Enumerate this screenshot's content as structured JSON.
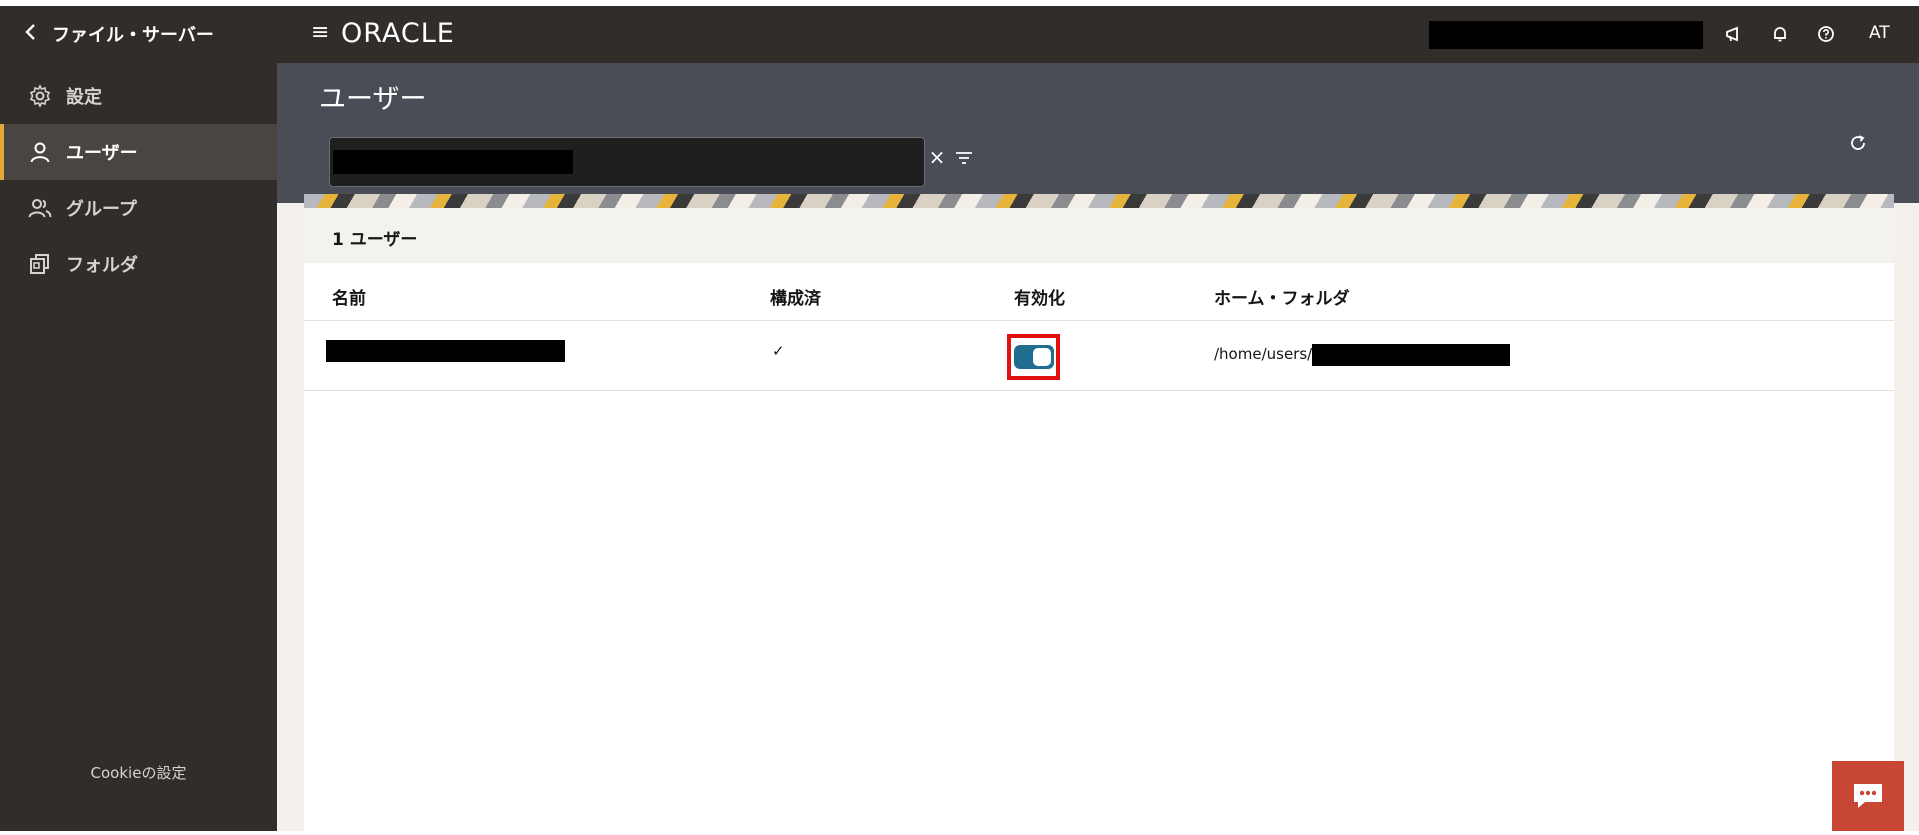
{
  "app": {
    "back_label": "ファイル・サーバー",
    "logo": "ORACLE",
    "initials": "AT"
  },
  "sidebar": {
    "items": [
      {
        "label": "設定",
        "icon": "gear-icon"
      },
      {
        "label": "ユーザー",
        "icon": "user-icon",
        "active": true
      },
      {
        "label": "グループ",
        "icon": "group-icon"
      },
      {
        "label": "フォルダ",
        "icon": "folder-icon"
      }
    ],
    "cookie_label": "Cookieの設定"
  },
  "page": {
    "title": "ユーザー"
  },
  "search": {
    "value": "",
    "clear": "×"
  },
  "list": {
    "count": "1 ユーザー",
    "columns": [
      "名前",
      "構成済",
      "有効化",
      "ホーム・フォルダ"
    ],
    "rows": [
      {
        "name": "",
        "configured": "✓",
        "enabled": true,
        "home_folder": "/home/users/"
      }
    ]
  },
  "colors": {
    "accent": "#e2a838",
    "toggle_on": "#1f6d8f",
    "highlight": "#e0110f",
    "chat": "#c74634"
  }
}
